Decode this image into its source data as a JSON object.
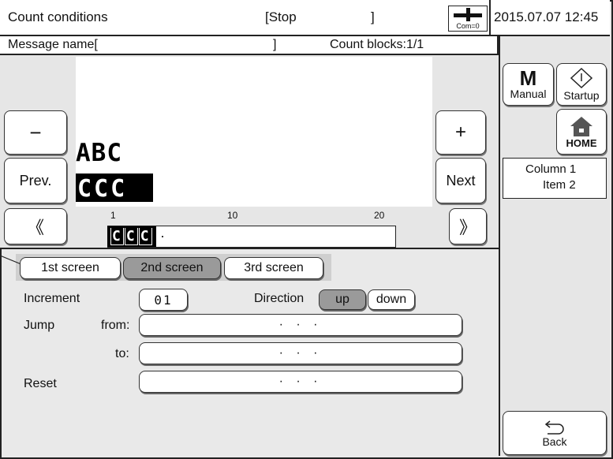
{
  "header": {
    "title": "Count conditions",
    "status_open": "[Stop",
    "status_close": "]",
    "com_label": "Com=0",
    "datetime": "2015.07.07 12:45"
  },
  "message_bar": {
    "name_label": "Message name[",
    "name_close": "]",
    "count_blocks": "Count blocks:1/1"
  },
  "preview": {
    "line1_text": "ABC",
    "line2_text": "CCC",
    "minus_label": "−",
    "prev_label": "Prev.",
    "plus_label": "+",
    "next_label": "Next",
    "nav_left": "《",
    "nav_right": "》",
    "ruler": [
      "1",
      "10",
      "20"
    ],
    "edit_chars": [
      "C",
      "C",
      "C"
    ],
    "edit_dot": "·"
  },
  "tabs": [
    {
      "label": "1st screen",
      "selected": false
    },
    {
      "label": "2nd screen",
      "selected": true
    },
    {
      "label": "3rd screen",
      "selected": false
    }
  ],
  "settings": {
    "increment_label": "Increment",
    "increment_value": "01",
    "direction_label": "Direction",
    "direction_up": "up",
    "direction_down": "down",
    "direction_selected": "up",
    "jump_label": "Jump",
    "from_label": "from:",
    "from_value": "· · ·",
    "to_label": "to:",
    "to_value": "· · ·",
    "reset_label": "Reset",
    "reset_value": "· · ·"
  },
  "right_panel": {
    "manual_big": "M",
    "manual_label": "Manual",
    "startup_label": "Startup",
    "home_label": "HOME",
    "column_line": "Column 1",
    "item_line": "Item 2",
    "back_label": "Back"
  },
  "colors": {
    "panel_bg": "#e6e6e6",
    "selected_bg": "#9a9a9a",
    "border": "#222222"
  }
}
